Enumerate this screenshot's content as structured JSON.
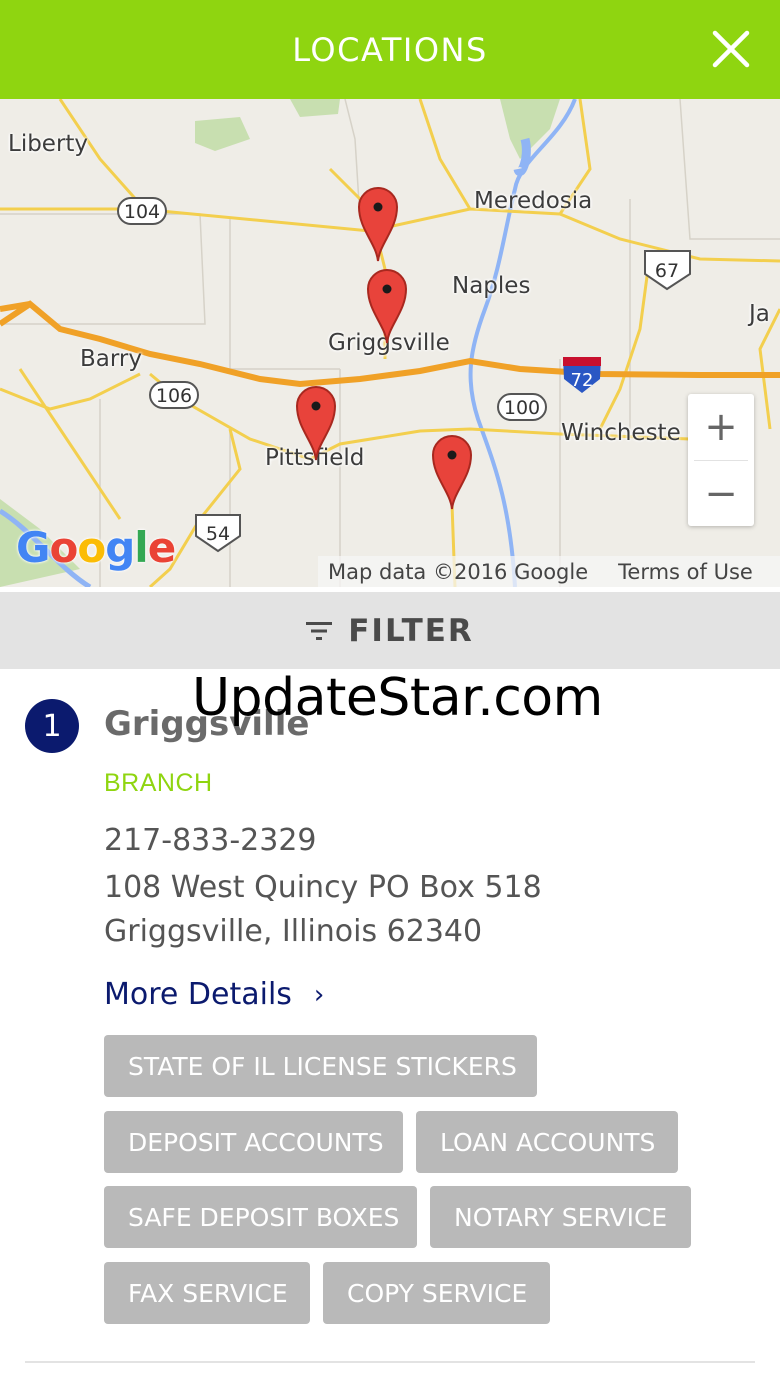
{
  "header": {
    "title": "LOCATIONS",
    "close_icon": "close-icon",
    "background": "#8fd510"
  },
  "map": {
    "labels": {
      "liberty": "Liberty",
      "meredosia": "Meredosia",
      "naples": "Naples",
      "ja": "Ja",
      "barry": "Barry",
      "griggsville": "Griggsville",
      "pittsfield": "Pittsfield",
      "winchester": "Wincheste"
    },
    "route_shields": {
      "r104": "104",
      "r67": "67",
      "r106": "106",
      "r100": "100",
      "r72": "72",
      "r54": "54"
    },
    "zoom_in": "+",
    "zoom_out": "−",
    "google_logo": "Google",
    "attribution": "Map data ©2016 Google",
    "terms": "Terms of Use",
    "marker_color": "#e8433b"
  },
  "filter": {
    "icon": "filter-icon",
    "label": "FILTER"
  },
  "watermark": "UpdateStar.com",
  "location": {
    "number": "1",
    "name": "Griggsville",
    "type": "BRANCH",
    "phone": "217-833-2329",
    "address1": "108 West Quincy PO Box 518",
    "address2": "Griggsville, Illinois 62340",
    "more_details": "More Details",
    "chevron": "›",
    "services": [
      "STATE OF IL LICENSE STICKERS",
      "DEPOSIT ACCOUNTS",
      "LOAN ACCOUNTS",
      "SAFE DEPOSIT BOXES",
      "NOTARY SERVICE",
      "FAX SERVICE",
      "COPY SERVICE"
    ]
  },
  "colors": {
    "accent_green": "#8fd510",
    "navy": "#0b1a6e",
    "tag_gray": "#b9b9b9"
  }
}
